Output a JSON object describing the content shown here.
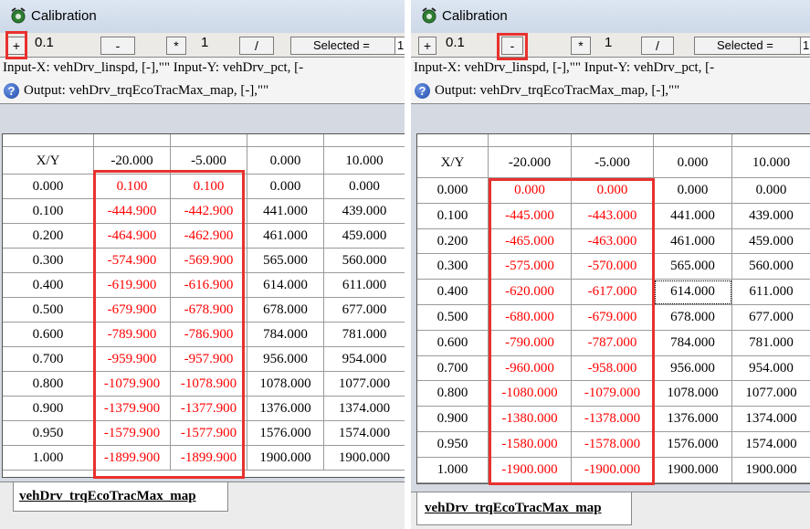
{
  "panels": [
    {
      "title": "Calibration",
      "toolbar": {
        "plus": "+",
        "step": "0.1",
        "minus": "-",
        "times": "*",
        "factor": "1",
        "divide": "/",
        "selected_label": "Selected =",
        "selected_value": "1"
      },
      "input_line": "Input-X: vehDrv_linspd, [-],\"\"   Input-Y: vehDrv_pct, [-",
      "output_line": "Output: vehDrv_trqEcoTracMax_map, [-],\"\"",
      "table": {
        "corner": "X/Y",
        "columns": [
          "-20.000",
          "-5.000",
          "0.000",
          "10.000"
        ],
        "rows": [
          {
            "y": "0.000",
            "cells": [
              "0.100",
              "0.100",
              "0.000",
              "0.000"
            ]
          },
          {
            "y": "0.100",
            "cells": [
              "-444.900",
              "-442.900",
              "441.000",
              "439.000"
            ]
          },
          {
            "y": "0.200",
            "cells": [
              "-464.900",
              "-462.900",
              "461.000",
              "459.000"
            ]
          },
          {
            "y": "0.300",
            "cells": [
              "-574.900",
              "-569.900",
              "565.000",
              "560.000"
            ]
          },
          {
            "y": "0.400",
            "cells": [
              "-619.900",
              "-616.900",
              "614.000",
              "611.000"
            ]
          },
          {
            "y": "0.500",
            "cells": [
              "-679.900",
              "-678.900",
              "678.000",
              "677.000"
            ]
          },
          {
            "y": "0.600",
            "cells": [
              "-789.900",
              "-786.900",
              "784.000",
              "781.000"
            ]
          },
          {
            "y": "0.700",
            "cells": [
              "-959.900",
              "-957.900",
              "956.000",
              "954.000"
            ]
          },
          {
            "y": "0.800",
            "cells": [
              "-1079.900",
              "-1078.900",
              "1078.000",
              "1077.000"
            ]
          },
          {
            "y": "0.900",
            "cells": [
              "-1379.900",
              "-1377.900",
              "1376.000",
              "1374.000"
            ]
          },
          {
            "y": "0.950",
            "cells": [
              "-1579.900",
              "-1577.900",
              "1576.000",
              "1574.000"
            ]
          },
          {
            "y": "1.000",
            "cells": [
              "-1899.900",
              "-1899.900",
              "1900.000",
              "1900.000"
            ]
          }
        ]
      },
      "tab_label": "vehDrv_trqEcoTracMax_map"
    },
    {
      "title": "Calibration",
      "toolbar": {
        "plus": "+",
        "step": "0.1",
        "minus": "-",
        "times": "*",
        "factor": "1",
        "divide": "/",
        "selected_label": "Selected =",
        "selected_value": "1"
      },
      "input_line": "Input-X: vehDrv_linspd, [-],\"\"   Input-Y: vehDrv_pct, [-",
      "output_line": "Output: vehDrv_trqEcoTracMax_map, [-],\"\"",
      "table": {
        "corner": "X/Y",
        "columns": [
          "-20.000",
          "-5.000",
          "0.000",
          "10.000"
        ],
        "rows": [
          {
            "y": "0.000",
            "cells": [
              "0.000",
              "0.000",
              "0.000",
              "0.000"
            ]
          },
          {
            "y": "0.100",
            "cells": [
              "-445.000",
              "-443.000",
              "441.000",
              "439.000"
            ]
          },
          {
            "y": "0.200",
            "cells": [
              "-465.000",
              "-463.000",
              "461.000",
              "459.000"
            ]
          },
          {
            "y": "0.300",
            "cells": [
              "-575.000",
              "-570.000",
              "565.000",
              "560.000"
            ]
          },
          {
            "y": "0.400",
            "cells": [
              "-620.000",
              "-617.000",
              "614.000",
              "611.000"
            ]
          },
          {
            "y": "0.500",
            "cells": [
              "-680.000",
              "-679.000",
              "678.000",
              "677.000"
            ]
          },
          {
            "y": "0.600",
            "cells": [
              "-790.000",
              "-787.000",
              "784.000",
              "781.000"
            ]
          },
          {
            "y": "0.700",
            "cells": [
              "-960.000",
              "-958.000",
              "956.000",
              "954.000"
            ]
          },
          {
            "y": "0.800",
            "cells": [
              "-1080.000",
              "-1079.000",
              "1078.000",
              "1077.000"
            ]
          },
          {
            "y": "0.900",
            "cells": [
              "-1380.000",
              "-1378.000",
              "1376.000",
              "1374.000"
            ]
          },
          {
            "y": "0.950",
            "cells": [
              "-1580.000",
              "-1578.000",
              "1576.000",
              "1574.000"
            ]
          },
          {
            "y": "1.000",
            "cells": [
              "-1900.000",
              "-1900.000",
              "1900.000",
              "1900.000"
            ]
          }
        ]
      },
      "tab_label": "vehDrv_trqEcoTracMax_map"
    }
  ],
  "colors": {
    "modified_value": "#ff0000",
    "highlight_box": "#e8312f"
  }
}
